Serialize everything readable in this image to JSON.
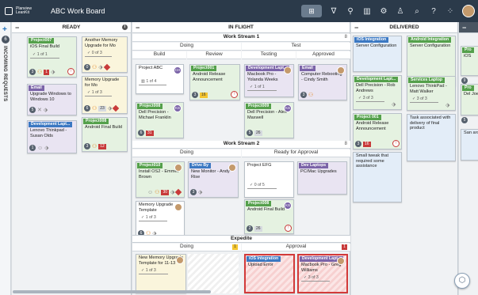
{
  "app": {
    "logo_text": "Planview LeanKit",
    "board_title": "ABC Work Board"
  },
  "toolbar": {
    "icons": [
      "add-card-icon",
      "filter-icon",
      "people-filter-icon",
      "analytics-icon",
      "settings-icon",
      "user-icon",
      "search-icon",
      "help-icon",
      "apps-icon",
      "avatar"
    ]
  },
  "rail": {
    "count": "6",
    "label": "INCOMING REQUESTS"
  },
  "lanes": {
    "ready": {
      "title": "READY"
    },
    "inflight": {
      "title": "IN FLIGHT"
    },
    "delivered": {
      "title": "DELIVERED"
    }
  },
  "ws1": {
    "title": "Work Stream 1",
    "count": "8",
    "doing": "Doing",
    "test": "Test",
    "build": "Build",
    "review": "Review",
    "testing": "Testing",
    "approved": "Approved"
  },
  "ws2": {
    "title": "Work Stream 2",
    "count": "8",
    "doing": "Doing",
    "ready_for_approval": "Ready for Approval"
  },
  "expedite": {
    "title": "Expedite",
    "doing": "Doing",
    "doing_badge": "1",
    "approval": "Approval",
    "approval_badge": "1"
  },
  "cards": {
    "r1": {
      "tag": "Project007",
      "title": "iOS Final Build",
      "check": "1 of 1",
      "num": "3",
      "badge": "1"
    },
    "r2": {
      "tag": "Email",
      "title": "Upgrade Windows to Windows 10",
      "num": "5"
    },
    "r3": {
      "tag": "Development Lapt...",
      "title": "Lenovo Thinkpad - Susan Olds",
      "num": "1"
    },
    "r4": {
      "title": "Another Memory Upgrade for Mo",
      "check": "0 of 3",
      "num": "0"
    },
    "r5": {
      "title": "Memory Upgrade for Mo",
      "check": "1 of 3",
      "num": "6",
      "badge": "23"
    },
    "r6": {
      "tag": "Project008",
      "title": "Android Final Build",
      "num": "3",
      "badge": "12"
    },
    "b1": {
      "title": "Project ABC",
      "check": "1 of 4",
      "av": "CH"
    },
    "rv1": {
      "tag": "Project001",
      "title": "Android Release Announcement",
      "num": "3",
      "badge": "16"
    },
    "b2": {
      "tag": "Project008",
      "title": "Dell Precision - Michael Franklin",
      "av": "KS",
      "num": "6",
      "badge": "31"
    },
    "t1": {
      "tag": "Development Lapt...",
      "title": "Macbook Pro - Yolanda Weeks",
      "check": "1 of 1",
      "av": "CH"
    },
    "t2": {
      "tag": "Project009",
      "title": "Dell Precision - Alex Maxwell",
      "av": "KS",
      "num": "5",
      "badge": "26"
    },
    "a1": {
      "tag": "Email",
      "title": "Computer Rebooting - Cindy Smith",
      "num": "3"
    },
    "w1": {
      "tag": "Project010",
      "title": "Install OS2 - Emmet Brown",
      "badge": "30"
    },
    "w2": {
      "tag": "Drive By",
      "title": "New Monitor - Andy Rise",
      "num": "3"
    },
    "w3": {
      "title": "Memory Upgrade Template",
      "check": "1 of 3",
      "num": "6"
    },
    "ra1": {
      "title": "Project EFG",
      "check": "0 of 5"
    },
    "ra2": {
      "tag": "Dev Laptops",
      "title": "PC/Mac Upgrades"
    },
    "ra3": {
      "tag": "Project008",
      "title": "Android Final Build",
      "av": "KS",
      "num": "2",
      "badge": "26"
    },
    "e1": {
      "title": "New Memory Upgrade Template for 11-13",
      "check": "1 of 3"
    },
    "e2": {
      "tag": "iOS Integration",
      "title": "Upload Error"
    },
    "e3": {
      "tag": "Development Lapt...",
      "title": "Macbook Pro - Greg Williams",
      "check": "3 of 3"
    },
    "d1": {
      "tag": "iOS Integration",
      "title": "Server Configuration"
    },
    "d2": {
      "tag": "Development Lapt...",
      "title": "Dell Precision - Rob Andrews",
      "check": "3 of 3"
    },
    "d3": {
      "tag": "Project 001",
      "title": "Android Release Announcement",
      "num": "3",
      "badge": "16"
    },
    "d4": {
      "title": "Small tweak that required some assistance"
    },
    "d5": {
      "tag": "Android Integration",
      "title": "Server Configuration",
      "num": "3"
    },
    "d6": {
      "tag": "Services Laptop",
      "title": "Lenovo ThinkPad - Matt Walker",
      "check": "3 of 3"
    },
    "d7": {
      "title": "Task associated with delivery of final product"
    },
    "x1": {
      "tag": "Pro",
      "title": "iOS"
    },
    "x2": {
      "tag": "Pro",
      "title": "Del Joe"
    },
    "x3": {
      "title": "San arc"
    },
    "x_num1": "9",
    "x_num2": "5"
  }
}
